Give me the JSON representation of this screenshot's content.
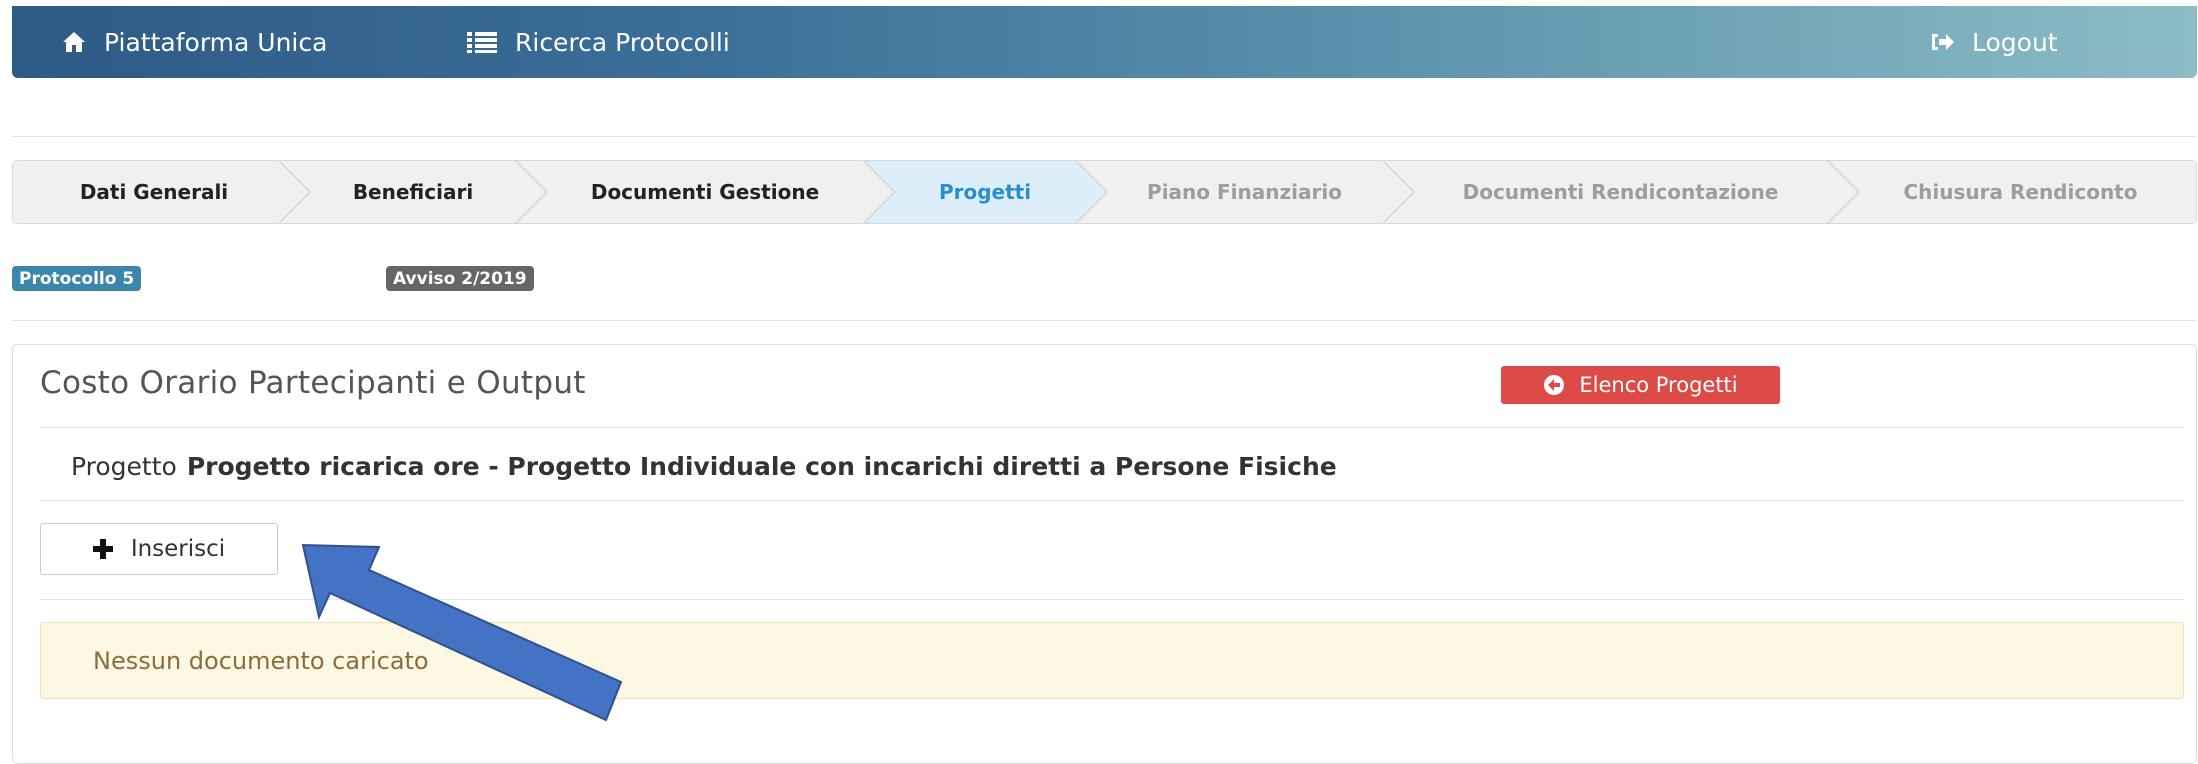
{
  "navbar": {
    "home": {
      "label": "Piattaforma Unica",
      "icon": "home-icon"
    },
    "ricerca": {
      "label": "Ricerca Protocolli",
      "icon": "list-icon"
    },
    "logout": {
      "label": "Logout",
      "icon": "sign-out-icon"
    }
  },
  "wizard": {
    "steps": [
      {
        "label": "Dati Generali",
        "state": "done"
      },
      {
        "label": "Beneficiari",
        "state": "done"
      },
      {
        "label": "Documenti Gestione",
        "state": "done"
      },
      {
        "label": "Progetti",
        "state": "current"
      },
      {
        "label": "Piano Finanziario",
        "state": "todo"
      },
      {
        "label": "Documenti Rendicontazione",
        "state": "todo"
      },
      {
        "label": "Chiusura Rendiconto",
        "state": "todo"
      }
    ]
  },
  "badges": {
    "protocollo": "Protocollo 5",
    "avviso": "Avviso 2/2019"
  },
  "panel": {
    "title": "Costo Orario Partecipanti e Output",
    "elenco_button": "Elenco Progetti",
    "progetto_label": "Progetto",
    "progetto_name": "Progetto ricarica ore - Progetto Individuale con incarichi diretti a Persone Fisiche",
    "inserisci_button": "Inserisci",
    "alert_text": "Nessun documento caricato"
  },
  "colors": {
    "navbar_start": "#2e5a86",
    "navbar_end": "#8cbcc6",
    "step_current": "#2a8fcf",
    "step_current_bg": "#ddeefb",
    "danger": "#dd4b47",
    "badge_info": "#3a86ad",
    "badge_default": "#666666",
    "alert_bg": "#fcf8e3",
    "annotation_arrow": "#4472c4"
  }
}
